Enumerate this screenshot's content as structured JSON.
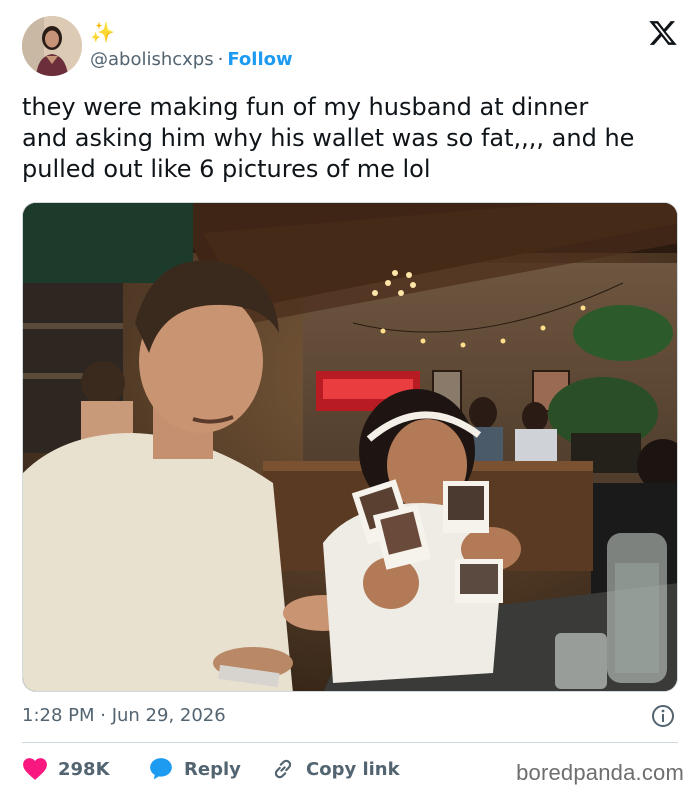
{
  "user": {
    "handle": "@abolishcxps",
    "separator": "·",
    "follow_label": "Follow",
    "badge_emoji": "✨"
  },
  "tweet": {
    "text": "they were making fun of my husband at dinner\nand asking him why his wallet was so fat,,,, and he\npulled out like 6 pictures of me lol"
  },
  "meta": {
    "timestamp": "1:28 PM · Jun 29, 2026"
  },
  "actions": {
    "likes": "298K",
    "reply_label": "Reply",
    "copy_link_label": "Copy link"
  },
  "watermark": "boredpanda.com",
  "colors": {
    "accent": "#1d9bf0",
    "like": "#f91880",
    "text": "#0f1419",
    "muted": "#536471",
    "border": "#cfd9de"
  },
  "icons": {
    "close": "x-logo-icon",
    "info": "info-icon",
    "like": "heart-icon",
    "reply": "speech-bubble-icon",
    "copy": "link-icon"
  }
}
